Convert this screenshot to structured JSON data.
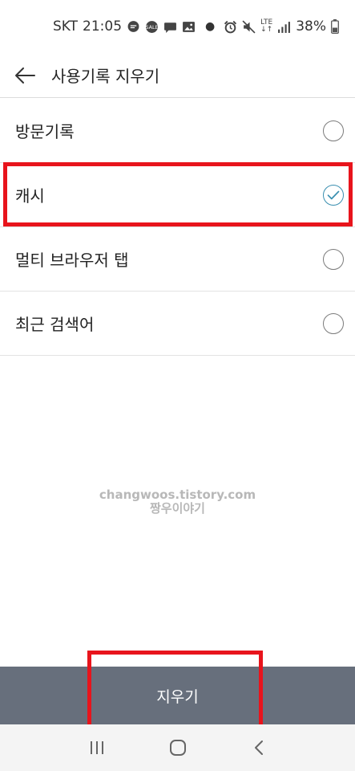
{
  "status_bar": {
    "carrier": "SKT",
    "time": "21:05",
    "battery": "38%",
    "network": "LTE",
    "icons": [
      "chat-bubble-icon",
      "sale-icon",
      "message-icon",
      "image-icon",
      "alarm-icon",
      "mute-icon",
      "lte-icon",
      "signal-icon",
      "battery-icon"
    ]
  },
  "header": {
    "title": "사용기록 지우기",
    "back_icon": "arrow-left-icon"
  },
  "options": [
    {
      "label": "방문기록",
      "checked": false
    },
    {
      "label": "캐시",
      "checked": true
    },
    {
      "label": "멀티 브라우저 탭",
      "checked": false
    },
    {
      "label": "최근 검색어",
      "checked": false
    }
  ],
  "watermark": {
    "line1": "changwoos.tistory.com",
    "line2": "짱우이야기"
  },
  "clear_button": {
    "label": "지우기"
  },
  "nav_bar": {
    "icons": [
      "recent-apps-icon",
      "home-icon",
      "back-icon"
    ]
  },
  "colors": {
    "accent": "#3a8fb0",
    "highlight": "#e8141c",
    "button_bg": "#676f7c"
  }
}
